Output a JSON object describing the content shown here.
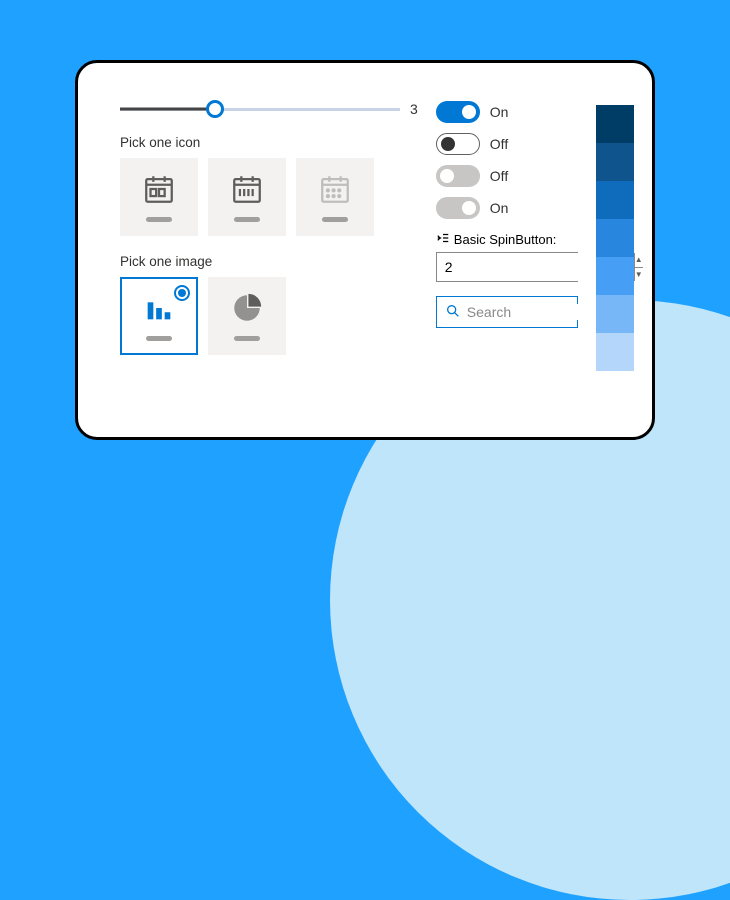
{
  "slider": {
    "value": "3"
  },
  "icon_picker": {
    "label": "Pick one icon"
  },
  "image_picker": {
    "label": "Pick one image"
  },
  "toggles": [
    {
      "label": "On"
    },
    {
      "label": "Off"
    },
    {
      "label": "Off"
    },
    {
      "label": "On"
    }
  ],
  "spin": {
    "label": "Basic SpinButton:",
    "value": "2"
  },
  "search": {
    "placeholder": "Search"
  },
  "swatches": [
    "#003d66",
    "#0f548c",
    "#0f6cbd",
    "#2886de",
    "#479ef5",
    "#77b7f7",
    "#b4d6fa"
  ]
}
